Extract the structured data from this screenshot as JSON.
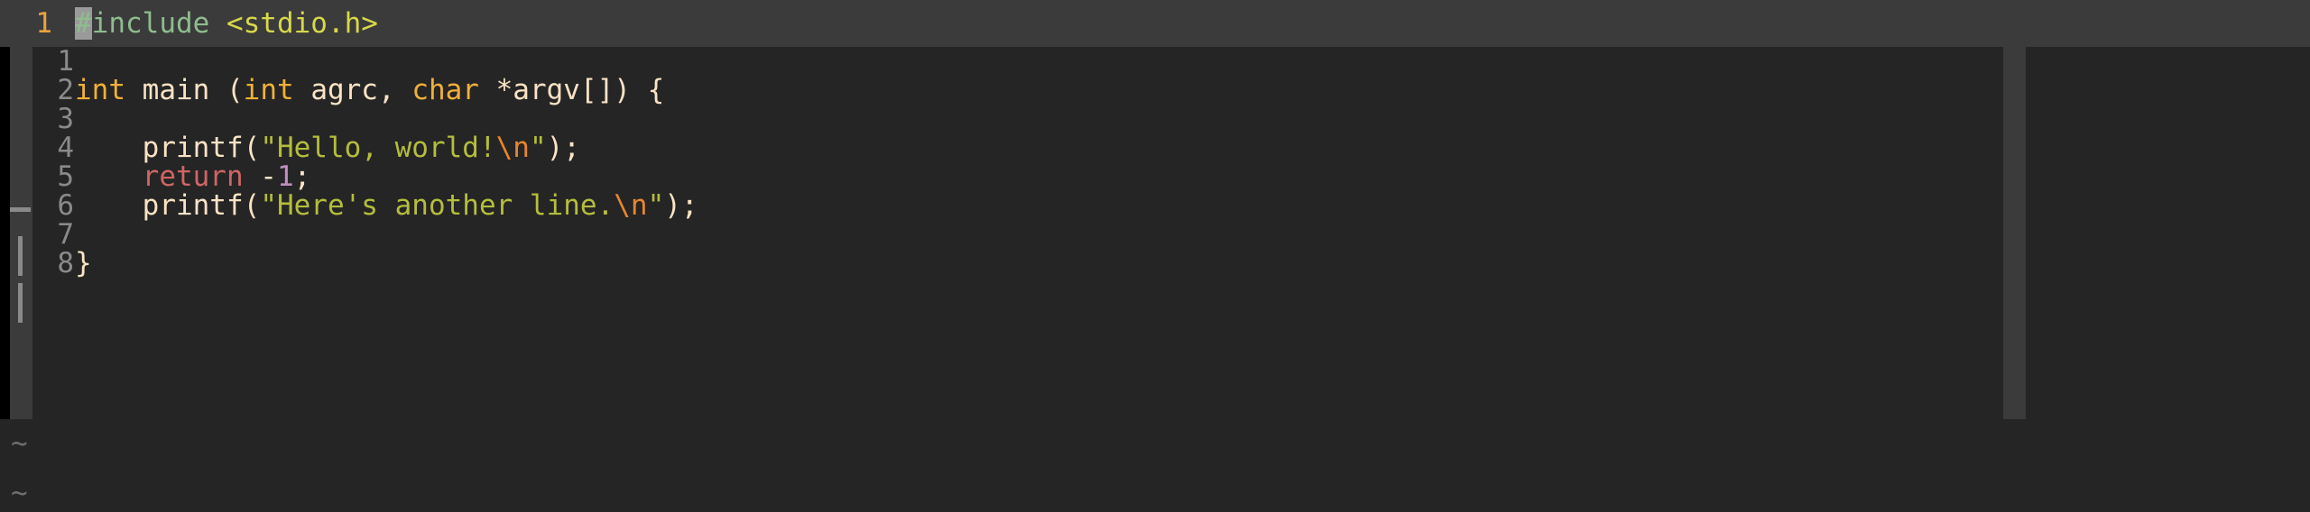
{
  "app": {
    "kind": "terminal-text-editor",
    "background": "#000000",
    "panel_background": "#252525",
    "chrome_background": "#3b3b3b"
  },
  "colors": {
    "line_number": "#8a8a8a",
    "active_line_number": "#e8a33d",
    "plain_text": "#fae3c5",
    "preprocessor": "#8fbc8f",
    "include_path": "#d8d84b",
    "type_keyword": "#f0b03a",
    "string_literal": "#b5bd3c",
    "escape_sequence": "#e8862d",
    "control_keyword": "#d06565",
    "number_literal": "#c08fc0",
    "cursor_block": "#9a9a9a"
  },
  "top_window": {
    "line_number": "1",
    "tokens": [
      {
        "text": "#",
        "style": "preprocessor",
        "cursor": true
      },
      {
        "text": "include ",
        "style": "preprocessor"
      },
      {
        "text": "<stdio.h>",
        "style": "include_path"
      }
    ]
  },
  "gutter": {
    "marks": [
      "dash",
      "bar",
      "bar"
    ],
    "empty_line_marker": "~",
    "empty_markers": [
      "~",
      "~"
    ]
  },
  "editor": {
    "lines": [
      {
        "number": "1",
        "tokens": []
      },
      {
        "number": "2",
        "tokens": [
          {
            "text": "int",
            "style": "type_keyword"
          },
          {
            "text": " main (",
            "style": "plain_text"
          },
          {
            "text": "int",
            "style": "type_keyword"
          },
          {
            "text": " agrc, ",
            "style": "plain_text"
          },
          {
            "text": "char",
            "style": "type_keyword"
          },
          {
            "text": " *argv[]) {",
            "style": "plain_text"
          }
        ]
      },
      {
        "number": "3",
        "tokens": []
      },
      {
        "number": "4",
        "tokens": [
          {
            "text": "    printf(",
            "style": "plain_text"
          },
          {
            "text": "\"Hello, world!",
            "style": "string_literal"
          },
          {
            "text": "\\n",
            "style": "escape_sequence"
          },
          {
            "text": "\"",
            "style": "string_literal"
          },
          {
            "text": ");",
            "style": "plain_text"
          }
        ]
      },
      {
        "number": "5",
        "tokens": [
          {
            "text": "    ",
            "style": "plain_text"
          },
          {
            "text": "return",
            "style": "control_keyword"
          },
          {
            "text": " -",
            "style": "plain_text"
          },
          {
            "text": "1",
            "style": "number_literal"
          },
          {
            "text": ";",
            "style": "plain_text"
          }
        ]
      },
      {
        "number": "6",
        "tokens": [
          {
            "text": "    printf(",
            "style": "plain_text"
          },
          {
            "text": "\"Here's another line.",
            "style": "string_literal"
          },
          {
            "text": "\\n",
            "style": "escape_sequence"
          },
          {
            "text": "\"",
            "style": "string_literal"
          },
          {
            "text": ");",
            "style": "plain_text"
          }
        ]
      },
      {
        "number": "7",
        "tokens": []
      },
      {
        "number": "8",
        "tokens": [
          {
            "text": "}",
            "style": "plain_text"
          }
        ]
      }
    ]
  }
}
